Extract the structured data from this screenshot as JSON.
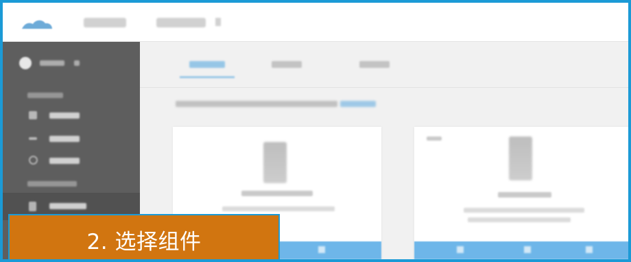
{
  "colors": {
    "frame_border": "#1b9ad6",
    "sidebar_bg": "#5e5e5e",
    "accent_blue": "#2f95dc",
    "overlay_orange": "#d17510"
  },
  "icons": {
    "logo": "cloud-logo-icon",
    "sidebar_avatar": "user-avatar-icon"
  },
  "overlay": {
    "label": "2. 选择组件"
  }
}
